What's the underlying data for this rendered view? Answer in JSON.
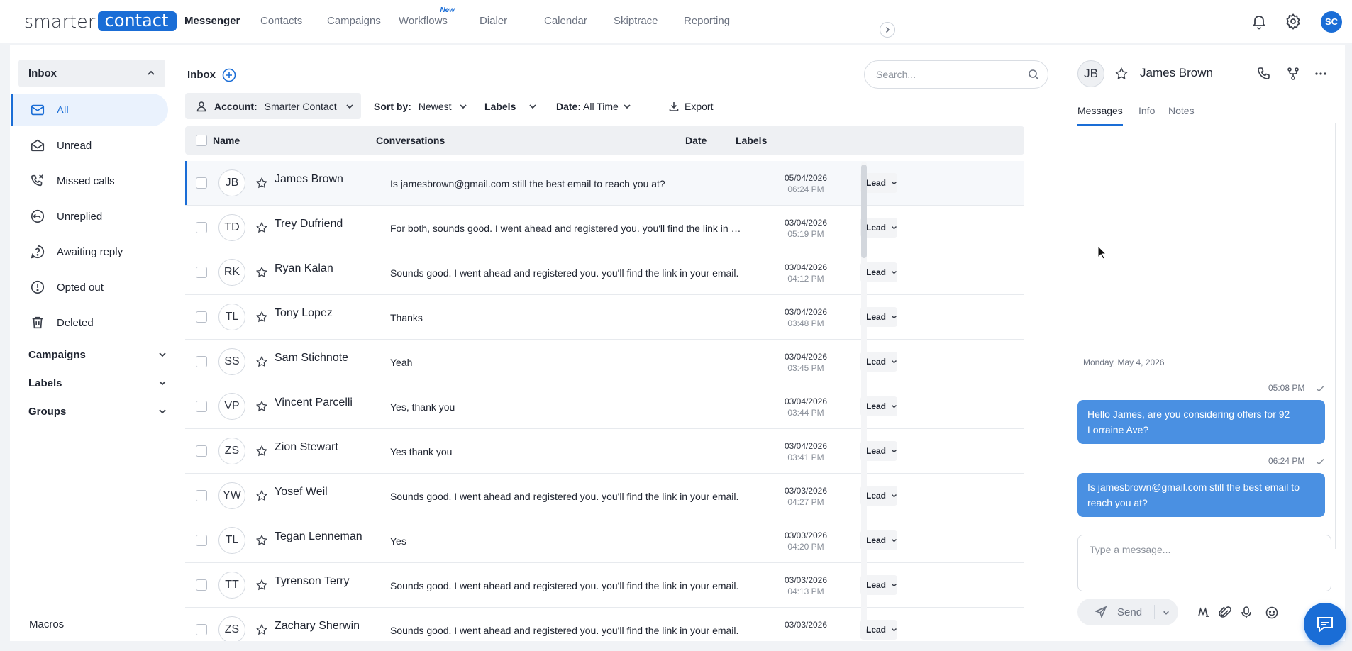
{
  "brand": {
    "word1": "smarter",
    "word2": "contact",
    "color": "#1a6dd6"
  },
  "nav": {
    "items": [
      {
        "label": "Messenger",
        "active": true
      },
      {
        "label": "Contacts"
      },
      {
        "label": "Campaigns"
      },
      {
        "label": "Workflows",
        "badge": "New"
      },
      {
        "label": "Dialer"
      },
      {
        "label": "Calendar"
      },
      {
        "label": "Skiptrace"
      },
      {
        "label": "Reporting"
      }
    ],
    "avatar_initials": "SC"
  },
  "sidebar": {
    "inbox_label": "Inbox",
    "items": [
      {
        "label": "All",
        "icon": "mail-icon",
        "active": true
      },
      {
        "label": "Unread",
        "icon": "envelope-open-icon"
      },
      {
        "label": "Missed calls",
        "icon": "missed-call-icon"
      },
      {
        "label": "Unreplied",
        "icon": "reply-icon"
      },
      {
        "label": "Awaiting reply",
        "icon": "question-icon"
      },
      {
        "label": "Opted out",
        "icon": "alert-icon"
      },
      {
        "label": "Deleted",
        "icon": "trash-icon"
      }
    ],
    "sections": [
      {
        "label": "Campaigns"
      },
      {
        "label": "Labels"
      },
      {
        "label": "Groups"
      }
    ],
    "macros_label": "Macros"
  },
  "main": {
    "title": "Inbox",
    "search_placeholder": "Search...",
    "filters": {
      "account_label": "Account:",
      "account_value": "Smarter Contact",
      "sort_label": "Sort by:",
      "sort_value": "Newest",
      "labels_label": "Labels",
      "date_label": "Date:",
      "date_value": "All Time",
      "export_label": "Export"
    },
    "columns": {
      "name": "Name",
      "conversations": "Conversations",
      "date": "Date",
      "labels": "Labels"
    },
    "rows": [
      {
        "initials": "JB",
        "name": "James Brown",
        "message": "Is jamesbrown@gmail.com still the best email to reach you at?",
        "date": "05/04/2026",
        "time": "06:24 PM",
        "label": "Lead"
      },
      {
        "initials": "TD",
        "name": "Trey Dufriend",
        "message": "For both, sounds good. I went ahead and registered you. you'll find the link in your email.",
        "date": "03/04/2026",
        "time": "05:19 PM",
        "label": "Lead"
      },
      {
        "initials": "RK",
        "name": "Ryan Kalan",
        "message": "Sounds good. I went ahead and registered you. you'll find the link in your email.",
        "date": "03/04/2026",
        "time": "04:12 PM",
        "label": "Lead"
      },
      {
        "initials": "TL",
        "name": "Tony Lopez",
        "message": "Thanks",
        "date": "03/04/2026",
        "time": "03:48 PM",
        "label": "Lead"
      },
      {
        "initials": "SS",
        "name": "Sam Stichnote",
        "message": "Yeah",
        "date": "03/04/2026",
        "time": "03:45 PM",
        "label": "Lead"
      },
      {
        "initials": "VP",
        "name": "Vincent Parcelli",
        "message": "Yes, thank you",
        "date": "03/04/2026",
        "time": "03:44 PM",
        "label": "Lead"
      },
      {
        "initials": "ZS",
        "name": "Zion Stewart",
        "message": "Yes thank you",
        "date": "03/04/2026",
        "time": "03:41 PM",
        "label": "Lead"
      },
      {
        "initials": "YW",
        "name": "Yosef Weil",
        "message": "Sounds good. I went ahead and registered you. you'll find the link in your email.",
        "date": "03/03/2026",
        "time": "04:27 PM",
        "label": "Lead"
      },
      {
        "initials": "TL",
        "name": "Tegan Lenneman",
        "message": "Yes",
        "date": "03/03/2026",
        "time": "04:20 PM",
        "label": "Lead"
      },
      {
        "initials": "TT",
        "name": "Tyrenson Terry",
        "message": "Sounds good. I went ahead and registered you. you'll find the link in your email.",
        "date": "03/03/2026",
        "time": "04:13 PM",
        "label": "Lead"
      },
      {
        "initials": "ZS",
        "name": "Zachary Sherwin",
        "message": "Sounds good. I went ahead and registered you. you'll find the link in your email.",
        "date": "03/03/2026",
        "time": "",
        "label": "Lead"
      }
    ]
  },
  "contact": {
    "initials": "JB",
    "name": "James Brown",
    "tabs": [
      {
        "label": "Messages",
        "active": true
      },
      {
        "label": "Info"
      },
      {
        "label": "Notes"
      }
    ],
    "day_label": "Monday, May 4, 2026",
    "messages": [
      {
        "time": "05:08 PM",
        "text": "Hello James, are you considering offers for 92 Lorraine Ave?"
      },
      {
        "time": "06:24 PM",
        "text": "Is jamesbrown@gmail.com still the best email to reach you at?"
      }
    ],
    "compose_placeholder": "Type a message...",
    "send_label": "Send"
  }
}
